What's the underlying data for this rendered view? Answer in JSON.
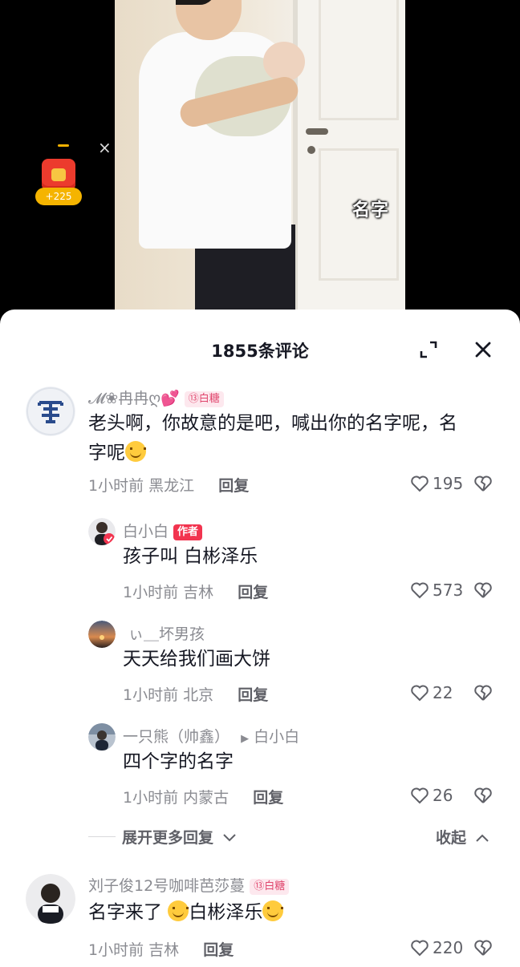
{
  "video": {
    "caption": "名字",
    "redpack_amount": "+225",
    "close_glyph": "×"
  },
  "sheet": {
    "title": "1855条评论"
  },
  "comments": [
    {
      "username": "𝓜❀冉冉ღ💕",
      "badge": "⑬白糖",
      "text": "老头啊，你故意的是吧，喊出你的名字呢，名字呢",
      "time": "1小时前",
      "location": "黑龙江",
      "reply": "回复",
      "likes": "195"
    },
    {
      "username": "白小白",
      "badge": "作者",
      "text": "孩子叫 白彬泽乐",
      "time": "1小时前",
      "location": "吉林",
      "reply": "回复",
      "likes": "573"
    },
    {
      "username": "ぃ＿坏男孩",
      "text": "天天给我们画大饼",
      "time": "1小时前",
      "location": "北京",
      "reply": "回复",
      "likes": "22"
    },
    {
      "username": "一只熊（帅鑫）",
      "reply_to": "白小白",
      "text": "四个字的名字",
      "time": "1小时前",
      "location": "内蒙古",
      "reply": "回复",
      "likes": "26"
    },
    {
      "username": "刘子俊12号咖啡芭莎蔓",
      "badge": "⑬白糖",
      "text_a": "名字来了",
      "text_b": "白彬泽乐",
      "time": "1小时前",
      "location": "吉林",
      "reply": "回复",
      "likes": "220"
    }
  ],
  "more_replies": "展开更多回复",
  "collapse": "收起",
  "colors": {
    "accent": "#f2344f",
    "badge_sugar": "#e0476e",
    "text": "#161823",
    "muted": "#8a8b91"
  }
}
